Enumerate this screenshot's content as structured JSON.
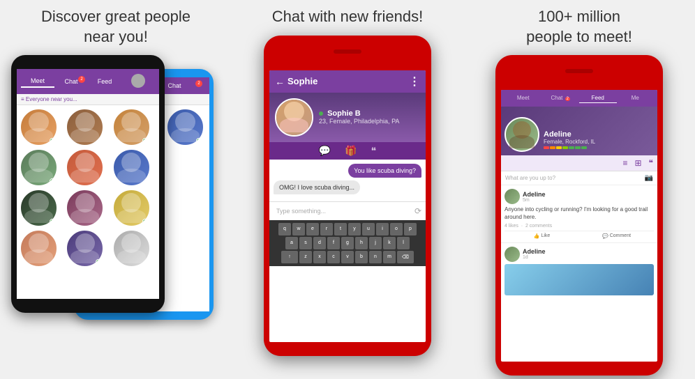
{
  "panels": {
    "left": {
      "title": "Discover great people\nnear you!",
      "nearby_label": "≡  Everyone near you...",
      "tabs": [
        "Meet",
        "Chat",
        "Feed"
      ]
    },
    "middle": {
      "title": "Chat with new friends!",
      "chat_header_name": "Sophie",
      "profile_name": "Sophie B",
      "profile_detail": "23, Female, Philadelphia, PA",
      "msg_received": "OMG! I love scuba diving...",
      "msg_sent": "You like scuba diving?",
      "input_placeholder": "Type something...",
      "keyboard_rows": [
        [
          "q",
          "w",
          "e",
          "r",
          "t",
          "y",
          "u",
          "i",
          "o",
          "p"
        ],
        [
          "a",
          "s",
          "d",
          "f",
          "g",
          "h",
          "j",
          "k",
          "l"
        ],
        [
          "↑",
          "z",
          "x",
          "c",
          "v",
          "b",
          "n",
          "m",
          "⌫"
        ]
      ]
    },
    "right": {
      "title": "100+ million\npeople to meet!",
      "profile_name": "Adeline",
      "profile_location": "Female, Rockford, IL",
      "tabs": [
        "Meet",
        "Chat",
        "Feed",
        "Me"
      ],
      "feed_placeholder": "What are you up to?",
      "post1": {
        "author": "Adeline",
        "time": "5m",
        "text": "Anyone into cycling or running? I'm looking for a good trail around here.",
        "likes": "4 likes",
        "comments": "2 comments",
        "like_label": "Like",
        "comment_label": "Comment"
      },
      "post2": {
        "author": "Adeline",
        "time": "1d"
      }
    }
  }
}
